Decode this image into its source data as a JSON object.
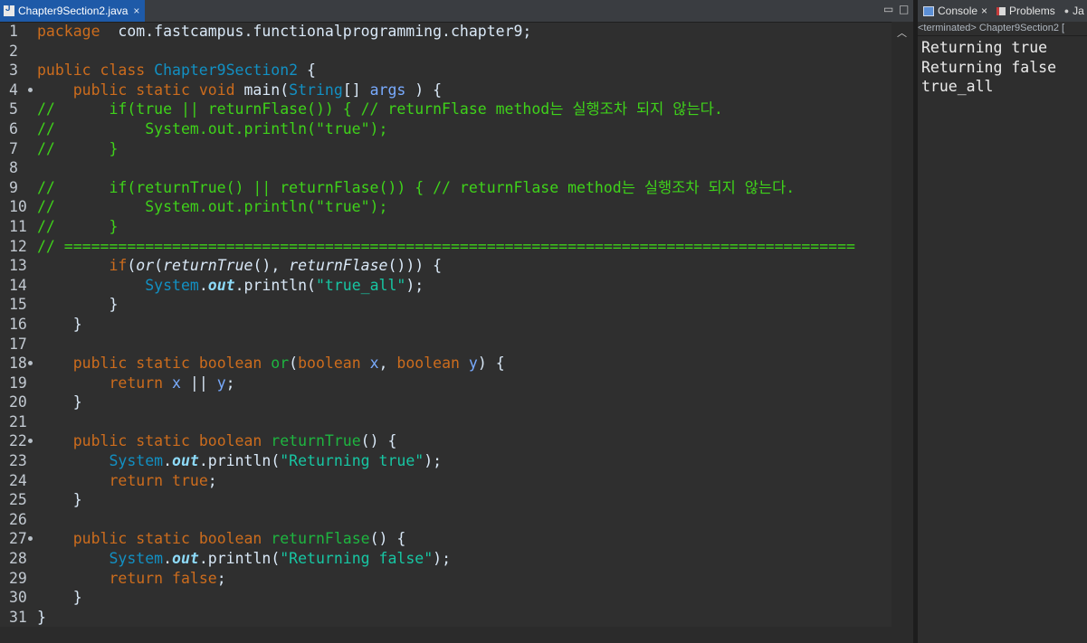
{
  "editor": {
    "tab_label": "Chapter9Section2.java",
    "tab_close": "×",
    "minimize": "▭",
    "maximize": "□",
    "line_numbers": [
      "1",
      "2",
      "3",
      "4",
      "5",
      "6",
      "7",
      "8",
      "9",
      "10",
      "11",
      "12",
      "13",
      "14",
      "15",
      "16",
      "17",
      "18",
      "19",
      "20",
      "21",
      "22",
      "23",
      "24",
      "25",
      "26",
      "27",
      "28",
      "29",
      "30",
      "31"
    ],
    "lines": [
      [
        [
          "kw",
          "package"
        ],
        [
          "",
          "  com.fastcampus.functionalprogramming.chapter9;"
        ]
      ],
      [],
      [
        [
          "kw",
          "public class "
        ],
        [
          "ty",
          "Chapter9Section2"
        ],
        [
          "",
          " {"
        ]
      ],
      [
        [
          "",
          "    "
        ],
        [
          "kw",
          "public static void "
        ],
        [
          "",
          "main("
        ],
        [
          "ty",
          "String"
        ],
        [
          "",
          "[] "
        ],
        [
          "var",
          "args"
        ],
        [
          "",
          " ) {"
        ]
      ],
      [
        [
          "cm",
          "//      if(true || returnFlase()) { // returnFlase method는 실행조차 되지 않는다."
        ]
      ],
      [
        [
          "cm",
          "//          System.out.println(\"true\");"
        ]
      ],
      [
        [
          "cm",
          "//      }"
        ]
      ],
      [],
      [
        [
          "cm",
          "//      if(returnTrue() || returnFlase()) { // returnFlase method는 실행조차 되지 않는다."
        ]
      ],
      [
        [
          "cm",
          "//          System.out.println(\"true\");"
        ]
      ],
      [
        [
          "cm",
          "//      }"
        ]
      ],
      [
        [
          "cm",
          "// ========================================================================================"
        ]
      ],
      [
        [
          "",
          "        "
        ],
        [
          "kw",
          "if"
        ],
        [
          "",
          "("
        ],
        [
          "it",
          "or"
        ],
        [
          "",
          "("
        ],
        [
          "it",
          "returnTrue"
        ],
        [
          "",
          "(), "
        ],
        [
          "it",
          "returnFlase"
        ],
        [
          "",
          "())) {"
        ]
      ],
      [
        [
          "",
          "            "
        ],
        [
          "ty",
          "System"
        ],
        [
          "",
          "."
        ],
        [
          "fd",
          "out"
        ],
        [
          "",
          ".println("
        ],
        [
          "st",
          "\"true_all\""
        ],
        [
          "",
          ");"
        ]
      ],
      [
        [
          "",
          "        }"
        ]
      ],
      [
        [
          "",
          "    }"
        ]
      ],
      [],
      [
        [
          "",
          "    "
        ],
        [
          "kw",
          "public static boolean "
        ],
        [
          "fn",
          "or"
        ],
        [
          "",
          "("
        ],
        [
          "kw",
          "boolean "
        ],
        [
          "var",
          "x"
        ],
        [
          "",
          ", "
        ],
        [
          "kw",
          "boolean "
        ],
        [
          "var",
          "y"
        ],
        [
          "",
          ") {"
        ]
      ],
      [
        [
          "",
          "        "
        ],
        [
          "kw",
          "return "
        ],
        [
          "var",
          "x"
        ],
        [
          "",
          " || "
        ],
        [
          "var",
          "y"
        ],
        [
          "",
          ";"
        ]
      ],
      [
        [
          "",
          "    }"
        ]
      ],
      [],
      [
        [
          "",
          "    "
        ],
        [
          "kw",
          "public static boolean "
        ],
        [
          "fn",
          "returnTrue"
        ],
        [
          "",
          "() {"
        ]
      ],
      [
        [
          "",
          "        "
        ],
        [
          "ty",
          "System"
        ],
        [
          "",
          "."
        ],
        [
          "fd",
          "out"
        ],
        [
          "",
          ".println("
        ],
        [
          "st",
          "\"Returning true\""
        ],
        [
          "",
          ");"
        ]
      ],
      [
        [
          "",
          "        "
        ],
        [
          "kw",
          "return true"
        ],
        [
          "",
          ";"
        ]
      ],
      [
        [
          "",
          "    }"
        ]
      ],
      [],
      [
        [
          "",
          "    "
        ],
        [
          "kw",
          "public static boolean "
        ],
        [
          "fn",
          "returnFlase"
        ],
        [
          "",
          "() {"
        ]
      ],
      [
        [
          "",
          "        "
        ],
        [
          "ty",
          "System"
        ],
        [
          "",
          "."
        ],
        [
          "fd",
          "out"
        ],
        [
          "",
          ".println("
        ],
        [
          "st",
          "\"Returning false\""
        ],
        [
          "",
          ");"
        ]
      ],
      [
        [
          "",
          "        "
        ],
        [
          "kw",
          "return false"
        ],
        [
          "",
          ";"
        ]
      ],
      [
        [
          "",
          "    }"
        ]
      ],
      [
        [
          "",
          "}"
        ]
      ]
    ]
  },
  "console": {
    "tabs": [
      {
        "label": "Console",
        "close": "×"
      },
      {
        "label": "Problems",
        "close": ""
      },
      {
        "label": "Ja",
        "close": ""
      }
    ],
    "status": "<terminated> Chapter9Section2 [",
    "output": [
      "Returning true",
      "Returning false",
      "true_all"
    ]
  },
  "colors": {
    "keyword": "#cc6c1d",
    "type": "#1290c3",
    "comment": "#3fd21a",
    "string": "#17c6a3",
    "tab_active": "#1e5aa8"
  }
}
